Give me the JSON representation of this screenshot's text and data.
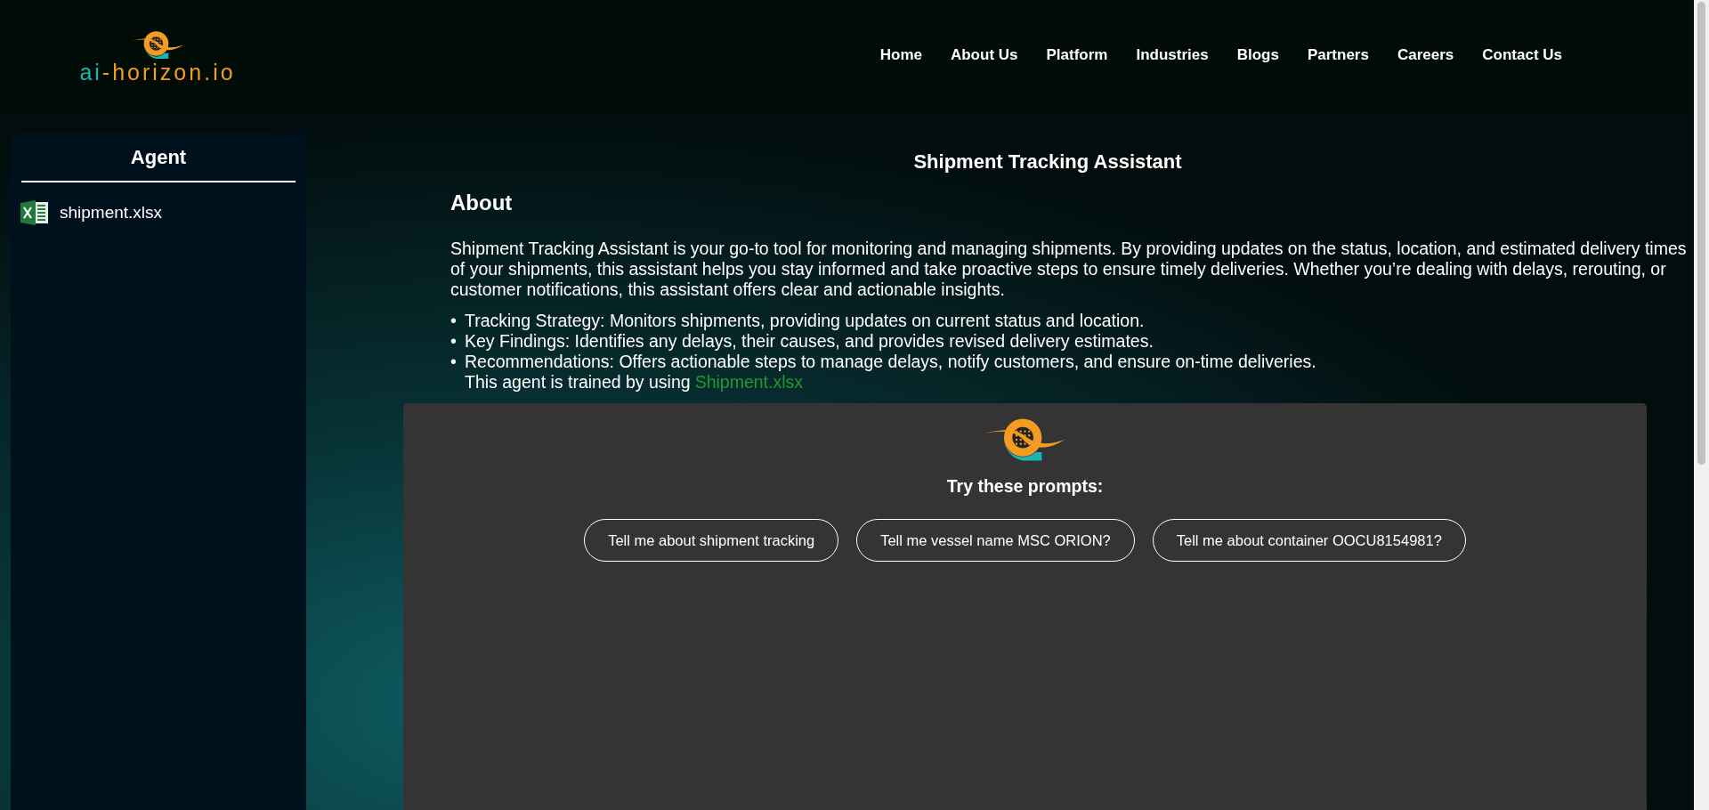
{
  "header": {
    "logo": {
      "parts": [
        {
          "text": "ai",
          "color": "#1bb5b8"
        },
        {
          "text": "-horizon.io",
          "color": "#f39c1f"
        }
      ]
    },
    "nav": [
      {
        "label": "Home"
      },
      {
        "label": "About Us"
      },
      {
        "label": "Platform"
      },
      {
        "label": "Industries"
      },
      {
        "label": "Blogs"
      },
      {
        "label": "Partners"
      },
      {
        "label": "Careers"
      },
      {
        "label": "Contact Us"
      }
    ]
  },
  "sidebar": {
    "title": "Agent",
    "files": [
      {
        "name": "shipment.xlsx"
      }
    ]
  },
  "main": {
    "title": "Shipment Tracking Assistant",
    "about_heading": "About",
    "description": "Shipment Tracking Assistant is your go-to tool for monitoring and managing shipments. By providing updates on the status, location, and estimated delivery times of your shipments, this assistant helps you stay informed and take proactive steps to ensure timely deliveries. Whether you’re dealing with delays, rerouting, or customer notifications, this assistant offers clear and actionable insights.",
    "bullets": [
      {
        "marker": "•",
        "text": "Tracking Strategy: Monitors shipments, providing updates on current status and location."
      },
      {
        "marker": "•",
        "text": "Key Findings: Identifies any delays, their causes, and provides revised delivery estimates."
      },
      {
        "marker": "•",
        "text": "Recommendations: Offers actionable steps to manage delays, notify customers, and ensure on-time deliveries."
      }
    ],
    "trained_text": "This agent is trained by using",
    "trained_link": "Shipment.xlsx"
  },
  "chat": {
    "prompts_heading": "Try these prompts:",
    "prompts": [
      "Tell me about shipment tracking",
      "Tell me vessel name MSC ORION?",
      "Tell me about container OOCU8154981?"
    ]
  }
}
